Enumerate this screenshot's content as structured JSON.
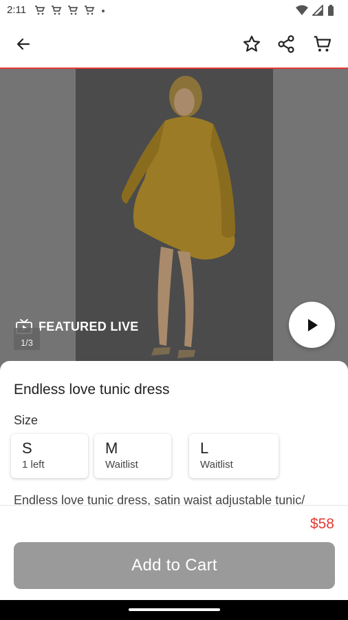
{
  "status_bar": {
    "time": "2:11",
    "left_icons": [
      "cart-notification-icon",
      "cart-notification-icon",
      "cart-notification-icon",
      "cart-notification-icon",
      "dot-icon"
    ],
    "right_icons": [
      "wifi-icon",
      "signal-icon",
      "battery-icon"
    ]
  },
  "header": {
    "back_icon": "arrow-left-icon",
    "favorite_icon": "star-outline-icon",
    "share_icon": "share-icon",
    "cart_icon": "cart-icon",
    "accent_color": "#e53935"
  },
  "media": {
    "badge_text": "FEATURED LIVE",
    "counter": "1/3",
    "play_icon": "play-icon"
  },
  "product": {
    "title": "Endless love tunic dress",
    "size_label": "Size",
    "sizes": [
      {
        "letter": "S",
        "status": "1 left"
      },
      {
        "letter": "M",
        "status": "Waitlist"
      },
      {
        "letter": "L",
        "status": "Waitlist"
      }
    ],
    "description": "Endless love tunic dress, satin waist adjustable tunic/",
    "price": "$58",
    "price_color": "#e53935"
  },
  "actions": {
    "add_to_cart": "Add to Cart"
  }
}
